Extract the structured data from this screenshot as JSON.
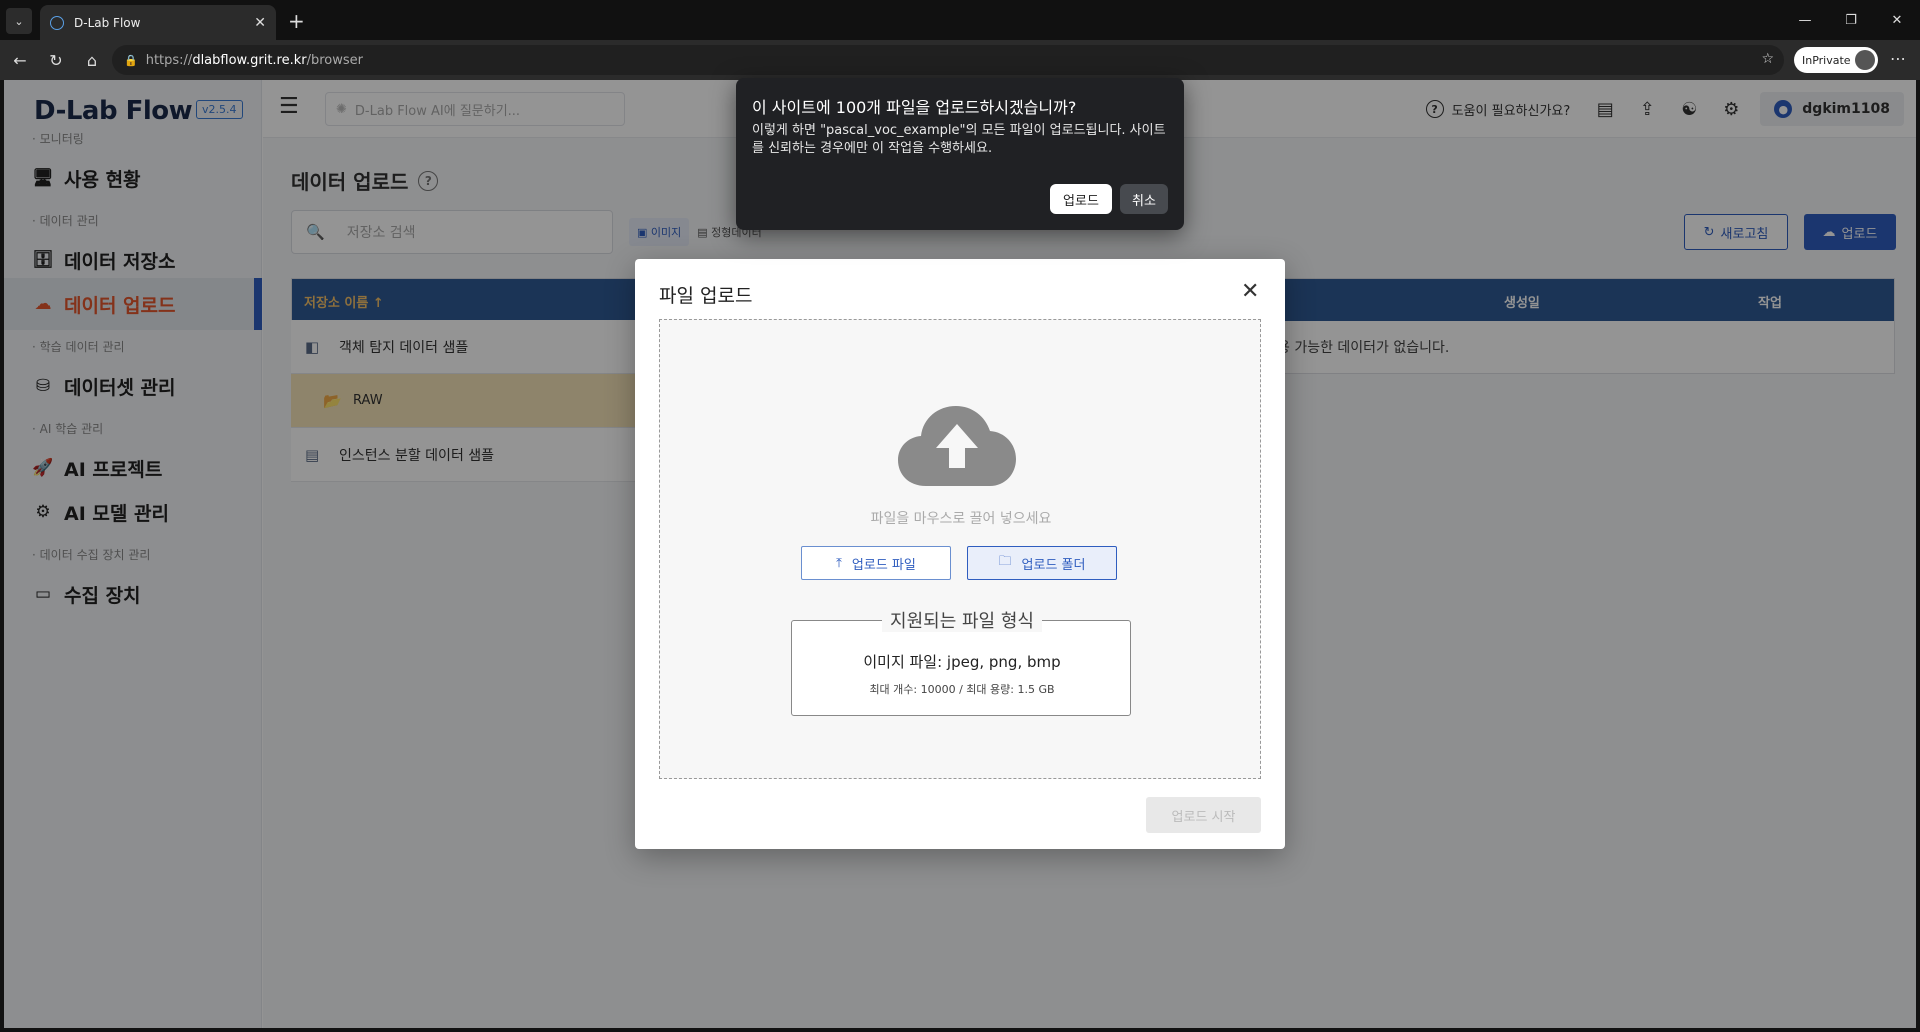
{
  "browser": {
    "tab_title": "D-Lab Flow",
    "url_prefix": "https://",
    "url_host": "dlabflow.grit.re.kr",
    "url_path": "/browser",
    "inprivate_label": "InPrivate"
  },
  "app": {
    "logo": "D-Lab Flow",
    "version": "v2.5.4",
    "ai_search_placeholder": "D-Lab Flow AI에 질문하기...",
    "help_label": "도움이 필요하신가요?",
    "username": "dgkim1108"
  },
  "sidebar": {
    "sections": [
      "모니터링",
      "데이터 관리",
      "학습 데이터 관리",
      "AI 학습 관리",
      "데이터 수집 장치 관리"
    ],
    "items": [
      {
        "label": "사용 현황",
        "icon": "monitor-chart-icon"
      },
      {
        "label": "데이터 저장소",
        "icon": "archive-icon"
      },
      {
        "label": "데이터 업로드",
        "icon": "cloud-upload-icon",
        "active": true
      },
      {
        "label": "데이터셋 관리",
        "icon": "dataset-icon"
      },
      {
        "label": "AI 프로젝트",
        "icon": "rocket-icon"
      },
      {
        "label": "AI 모델 관리",
        "icon": "model-icon"
      },
      {
        "label": "수집 장치",
        "icon": "device-icon"
      }
    ]
  },
  "page": {
    "title": "데이터 업로드",
    "search_placeholder": "저장소 검색",
    "type_tabs": [
      "이미지",
      "정형데이터"
    ],
    "refresh_label": "새로고침",
    "upload_label": "업로드",
    "columns": {
      "name": "저장소 이름 ↑",
      "created": "생성일",
      "action": "작업"
    },
    "empty_text": "용 가능한 데이터가 없습니다.",
    "tree": [
      {
        "label": "객체 탐지 데이터 샘플"
      },
      {
        "label": "RAW"
      },
      {
        "label": "인스턴스 분할 데이터 샘플"
      }
    ]
  },
  "modal": {
    "title": "파일 업로드",
    "drop_hint": "파일을 마우스로 끌어 넣으세요",
    "upload_file_label": "업로드 파일",
    "upload_folder_label": "업로드 폴더",
    "formats_legend": "지원되는 파일 형식",
    "formats_types": "이미지 파일: jpeg, png, bmp",
    "formats_limit": "최대 개수: 10000 / 최대 용량: 1.5 GB",
    "start_label": "업로드 시작"
  },
  "confirm": {
    "title": "이 사이트에 100개 파일을 업로드하시겠습니까?",
    "message": "이렇게 하면 \"pascal_voc_example\"의 모든 파일이 업로드됩니다. 사이트를 신뢰하는 경우에만 이 작업을 수행하세요.",
    "ok_label": "업로드",
    "cancel_label": "취소"
  },
  "colors": {
    "primary": "#2f5dbf",
    "active_nav_text": "#e4572e",
    "table_header": "#2f5a94",
    "selected_row": "#f4e4b8"
  }
}
